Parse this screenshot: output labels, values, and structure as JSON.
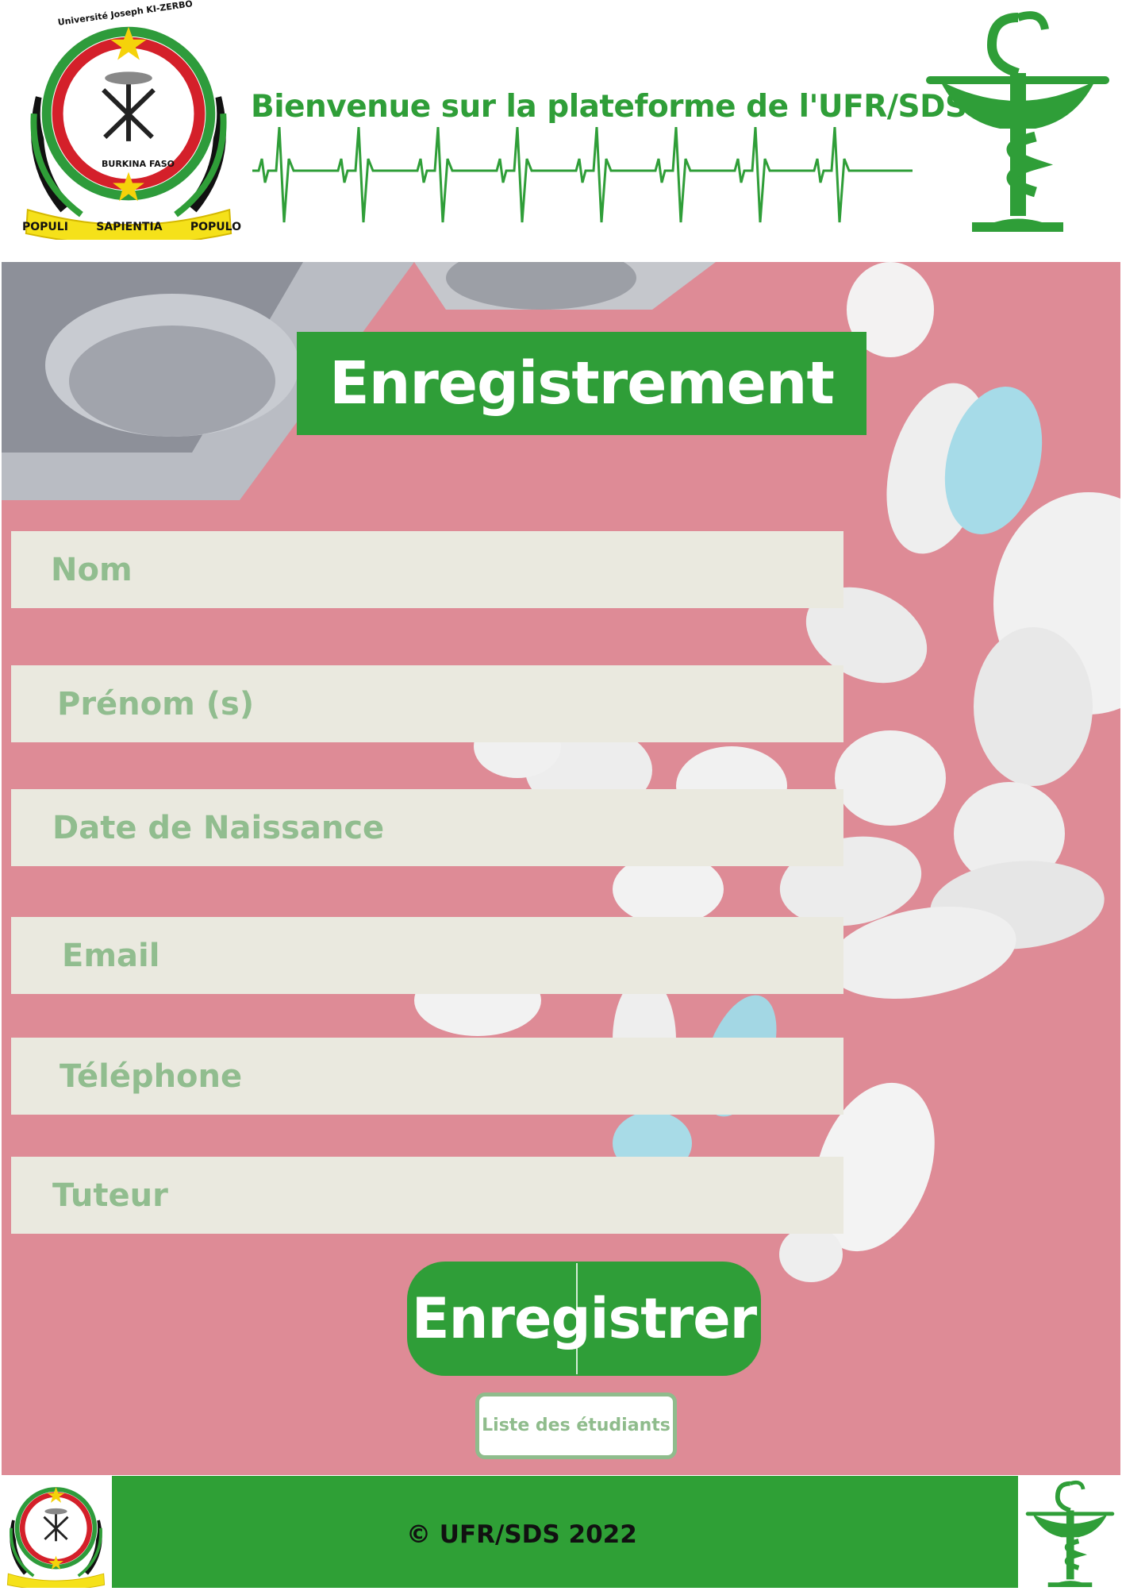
{
  "header": {
    "title": "Bienvenue sur la plateforme de l'UFR/SDS",
    "logo_left": {
      "top_text": "Université Joseph KI-ZERBO",
      "country": "BURKINA FASO",
      "motto": [
        "POPULI",
        "SAPIENTIA",
        "POPULO"
      ],
      "icon": "university-emblem"
    },
    "logo_right": {
      "icon": "pharmacy-snake-bowl-icon"
    },
    "ecg_icon": "heartbeat-line"
  },
  "form": {
    "title": "Enregistrement",
    "fields": [
      {
        "placeholder": "Nom",
        "value": ""
      },
      {
        "placeholder": "Prénom (s)",
        "value": ""
      },
      {
        "placeholder": "Date de Naissance",
        "value": ""
      },
      {
        "placeholder": "Email",
        "value": ""
      },
      {
        "placeholder": "Téléphone",
        "value": ""
      },
      {
        "placeholder": "Tuteur",
        "value": ""
      }
    ],
    "submit_label": "Enregistrer",
    "list_label": "Liste des étudiants",
    "background": "pills-on-pink-photo"
  },
  "footer": {
    "copyright": "© UFR/SDS 2022"
  },
  "colors": {
    "brand_green": "#2f9e38",
    "field_bg": "#eae9df",
    "field_text": "#91bd8f",
    "hero_pink": "#dc8a96"
  }
}
